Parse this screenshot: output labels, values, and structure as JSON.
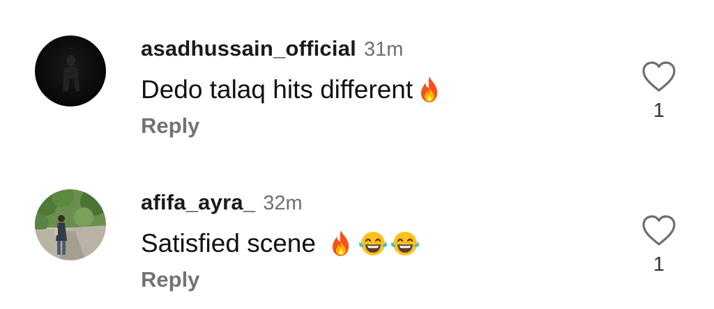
{
  "comments": [
    {
      "username": "asadhussain_official",
      "time": "31m",
      "text": "Dedo talaq hits different",
      "emojis": [
        "fire-emoji"
      ],
      "reply_label": "Reply",
      "like_count": "1",
      "avatar": "dark-figure-avatar"
    },
    {
      "username": "afifa_ayra_",
      "time": "32m",
      "text": "Satisfied scene ",
      "emojis": [
        "fire-emoji",
        "tears-of-joy-emoji",
        "tears-of-joy-emoji"
      ],
      "reply_label": "Reply",
      "like_count": "1",
      "avatar": "outdoor-portrait-avatar"
    }
  ],
  "icons": {
    "like": "heart-outline-icon"
  },
  "colors": {
    "username": "#1a1a1a",
    "timestamp": "#6f6f6f",
    "reply": "#737373",
    "background": "#ffffff"
  }
}
